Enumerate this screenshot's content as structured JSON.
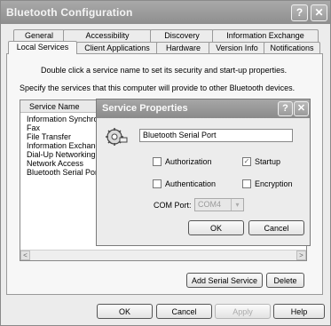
{
  "window": {
    "title": "Bluetooth Configuration",
    "help_glyph": "?",
    "close_glyph": "✕"
  },
  "tabs_row1": [
    "General",
    "Accessibility",
    "Discovery",
    "Information Exchange"
  ],
  "tabs_row2": [
    "Local Services",
    "Client Applications",
    "Hardware",
    "Version Info",
    "Notifications"
  ],
  "active_tab": "Local Services",
  "panel": {
    "instruction": "Double click a service name to set its security and start-up properties.",
    "specify_text": "Specify the services that this computer will provide to other Bluetooth devices."
  },
  "list": {
    "column_header": "Service Name",
    "items": [
      "Information Synchron",
      "Fax",
      "File Transfer",
      "Information Exchang",
      "Dial-Up Networking",
      "Network Access",
      "Bluetooth Serial Port"
    ]
  },
  "panel_buttons": {
    "add_serial": "Add Serial Service",
    "delete": "Delete"
  },
  "footer_buttons": {
    "ok": "OK",
    "cancel": "Cancel",
    "apply": "Apply",
    "help": "Help"
  },
  "dialog": {
    "title": "Service Properties",
    "help_glyph": "?",
    "close_glyph": "✕",
    "service_name_value": "Bluetooth Serial Port",
    "authorization_label": "Authorization",
    "authorization_checked": false,
    "startup_label": "Startup",
    "startup_checked": true,
    "authentication_label": "Authentication",
    "authentication_checked": false,
    "encryption_label": "Encryption",
    "encryption_checked": false,
    "com_port_label": "COM Port:",
    "com_port_value": "COM4",
    "ok_label": "OK",
    "cancel_label": "Cancel",
    "icon": "bluetooth-service-icon"
  },
  "scroll": {
    "left_glyph": "<",
    "right_glyph": ">"
  },
  "check_glyph": "✓",
  "combo_arrow_glyph": "▾"
}
